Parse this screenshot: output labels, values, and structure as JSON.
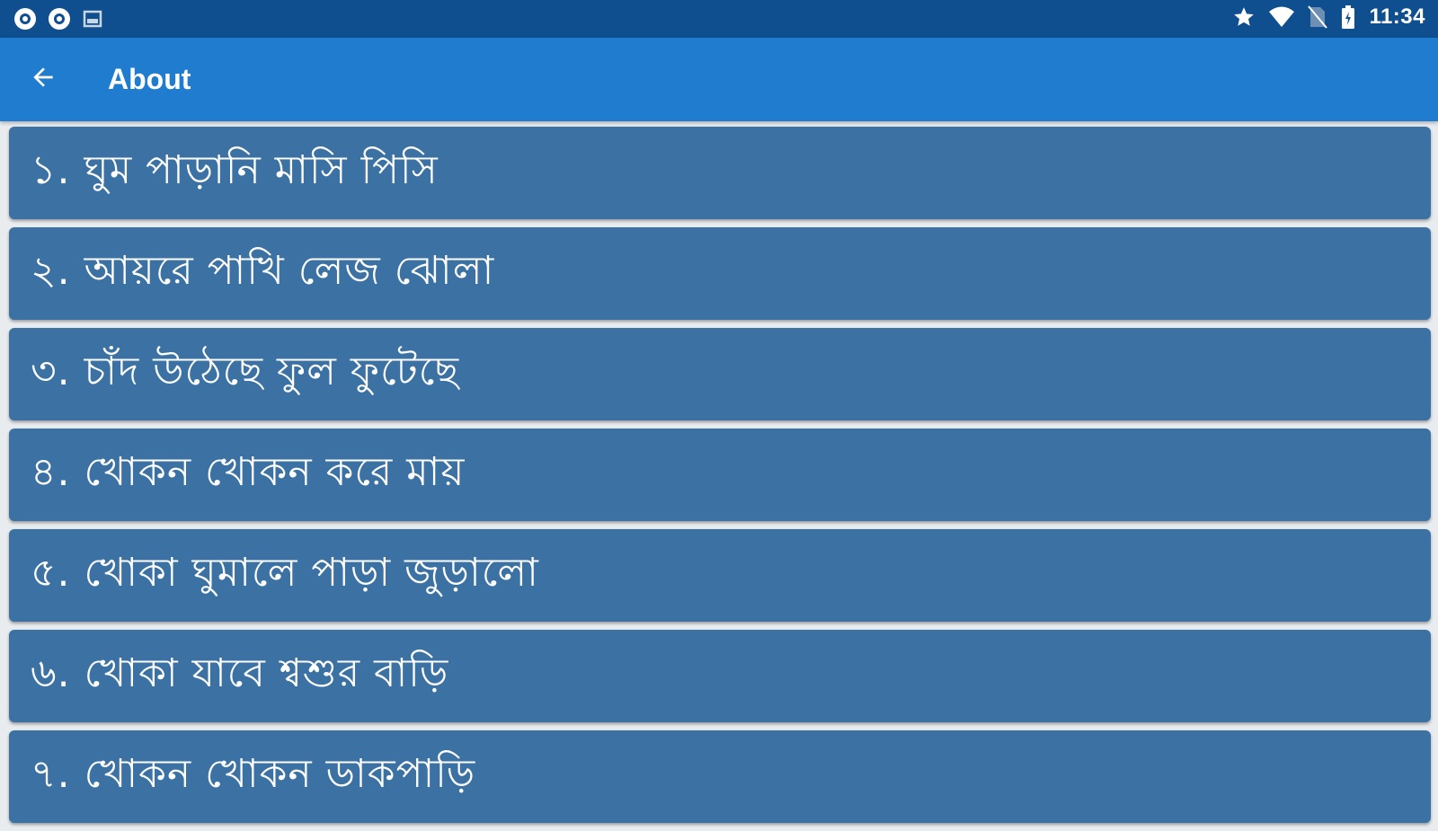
{
  "status_bar": {
    "left_icons": [
      "cast-icon",
      "cast-icon",
      "image-icon"
    ],
    "right_icons": [
      "star-icon",
      "wifi-icon",
      "no-sim-icon",
      "battery-icon"
    ],
    "time": "11:34"
  },
  "app_bar": {
    "back_icon": "arrow-back-icon",
    "title": "About"
  },
  "list": {
    "items": [
      {
        "label": "১. ঘুম পাড়ানি মাসি পিসি"
      },
      {
        "label": "২. আয়রে পাখি লেজ ঝোলা"
      },
      {
        "label": "৩. চাঁদ উঠেছে ফুল ফুটেছে"
      },
      {
        "label": "৪. খোকন খোকন করে মায়"
      },
      {
        "label": "৫. খোকা ঘুমালে পাড়া জুড়ালো"
      },
      {
        "label": "৬. খোকা যাবে শ্বশুর বাড়ি"
      },
      {
        "label": "৭. খোকন খোকন ডাকপাড়ি"
      }
    ]
  },
  "colors": {
    "status_bar": "#0f4e8f",
    "app_bar": "#1f7ccf",
    "list_item": "#3b72a3",
    "background": "#e8ecef",
    "text": "#ffffff"
  }
}
